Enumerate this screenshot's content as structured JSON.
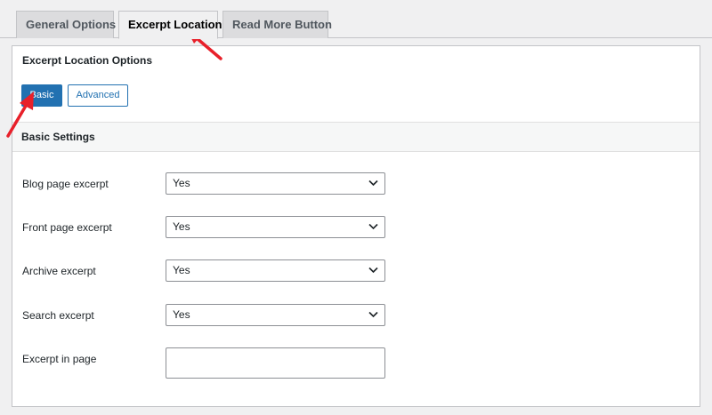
{
  "tabs": [
    {
      "label": "General Options",
      "active": false
    },
    {
      "label": "Excerpt Location",
      "active": true
    },
    {
      "label": "Read More Button",
      "active": false
    }
  ],
  "panel": {
    "title": "Excerpt Location Options",
    "mode_buttons": {
      "basic": "Basic",
      "advanced": "Advanced",
      "selected": "Basic"
    },
    "section_title": "Basic Settings",
    "rows": [
      {
        "label": "Blog page excerpt",
        "type": "select",
        "value": "Yes"
      },
      {
        "label": "Front page excerpt",
        "type": "select",
        "value": "Yes"
      },
      {
        "label": "Archive excerpt",
        "type": "select",
        "value": "Yes"
      },
      {
        "label": "Search excerpt",
        "type": "select",
        "value": "Yes"
      },
      {
        "label": "Excerpt in page",
        "type": "text",
        "value": ""
      }
    ]
  },
  "colors": {
    "accent": "#2271b1",
    "annotation": "#e8202a",
    "background": "#f0f0f1"
  },
  "annotations": [
    "arrow-to-excerpt-location-tab",
    "arrow-to-basic-button"
  ]
}
